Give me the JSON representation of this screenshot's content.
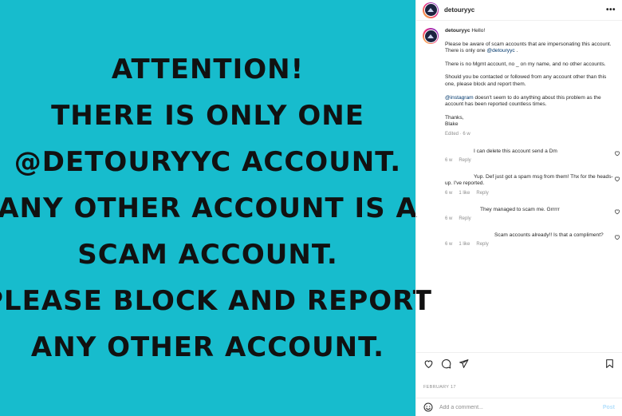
{
  "post_image": {
    "lines": [
      "ATTENTION!",
      "THERE IS ONLY ONE",
      "@DETOURYYC ACCOUNT.",
      "ANY OTHER ACCOUNT IS A",
      "SCAM ACCOUNT.",
      "PLEASE BLOCK AND REPORT",
      "ANY OTHER ACCOUNT."
    ],
    "background": "#17bccd"
  },
  "header": {
    "username": "detouryyc",
    "more_label": "•••"
  },
  "caption": {
    "username": "detouryyc",
    "greeting": "Hello!",
    "p1": "Please be aware of scam accounts that are impersonating this account.",
    "p1b_prefix": "There is only one ",
    "p1b_mention": "@detouryyc",
    "p1b_suffix": " .",
    "p2": "There is no Mgmt account, no _ on my name, and no other accounts.",
    "p3": "Should you be contacted or followed from any account other than this one, please block and report them.",
    "p4_mention": "@instagram",
    "p4_rest": " doesn't seem to do anything about this problem as the account has been reported countless times.",
    "signoff_1": "Thanks,",
    "signoff_2": "Blake",
    "meta": "Edited · 6 w"
  },
  "replies": [
    {
      "text": "I can delete this account send a Dm",
      "time": "6 w",
      "likes": "",
      "reply_label": "Reply"
    },
    {
      "text": "Yup. Def just got a spam msg from them! Thx for the heads-up. I've reported.",
      "time": "6 w",
      "likes": "1 like",
      "reply_label": "Reply"
    },
    {
      "text": "They managed to scam me. Grrrrr",
      "time": "6 w",
      "likes": "",
      "reply_label": "Reply"
    },
    {
      "text": "Scam accounts already!! Is that a compliment?",
      "time": "6 w",
      "likes": "1 like",
      "reply_label": "Reply"
    }
  ],
  "date": "FEBRUARY 17",
  "add_comment": {
    "placeholder": "Add a comment...",
    "post_label": "Post"
  },
  "colors": {
    "accent": "#0095f6",
    "post_disabled": "#b2dffc",
    "mention": "#00376b"
  }
}
